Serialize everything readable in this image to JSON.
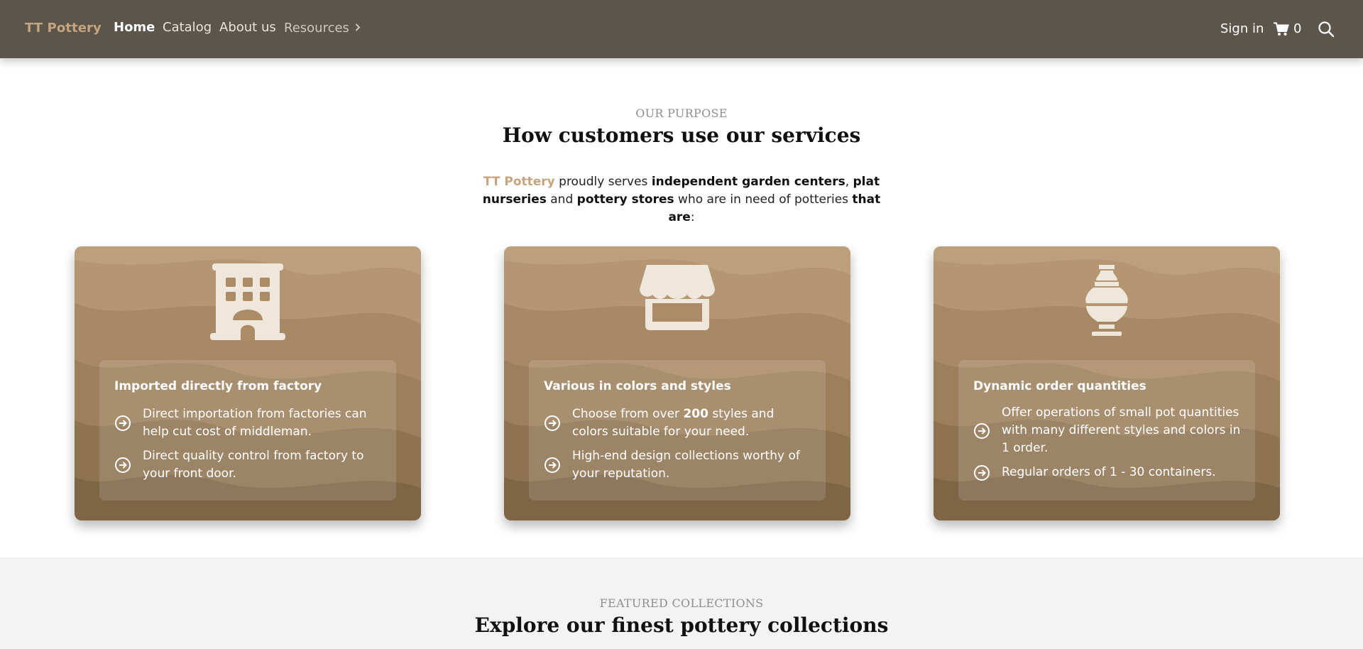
{
  "nav": {
    "brand": "TT Pottery",
    "links": [
      "Home",
      "Catalog",
      "About us",
      "Resources"
    ],
    "sign_in": "Sign in",
    "cart_count": "0",
    "icons": {
      "cart": "cart-icon",
      "search": "search-icon",
      "resources_caret": "chevron-right-icon"
    }
  },
  "purpose": {
    "eyebrow": "OUR PURPOSE",
    "title": "How customers use our services",
    "intro": {
      "brand": "TT Pottery",
      "t1": " proudly serves ",
      "b1": "independent garden centers",
      "t2": ", ",
      "b2": "plat nurseries",
      "t3": " and ",
      "b3": "pottery stores",
      "t4": " who are in need of potteries ",
      "b4": "that are",
      "t5": ":"
    }
  },
  "cards": [
    {
      "icon": "building-icon",
      "title": "Imported directly from factory",
      "items": [
        {
          "text": "Direct importation from factories can help cut cost of middleman."
        },
        {
          "text": "Direct quality control from factory to your front door."
        }
      ]
    },
    {
      "icon": "storefront-icon",
      "title": "Various in colors and styles",
      "items": [
        {
          "pre": "Choose from over ",
          "bold": "200",
          "post": " styles and colors suitable for your need."
        },
        {
          "text": "High-end design collections worthy of your reputation."
        }
      ]
    },
    {
      "icon": "vase-icon",
      "title": "Dynamic order quantities",
      "items": [
        {
          "text": "Offer operations of small pot quantities with many different styles and colors in 1 order."
        },
        {
          "text": "Regular orders of 1 - 30 containers."
        }
      ]
    }
  ],
  "featured": {
    "eyebrow": "FEATURED COLLECTIONS",
    "title": "Explore our finest pottery collections"
  },
  "colors": {
    "nav_bg": "#5c554c",
    "brand": "#c5a47e",
    "card_light": "#b79c78",
    "card_dark": "#7e6546",
    "section_bg": "#f3f3f3"
  }
}
